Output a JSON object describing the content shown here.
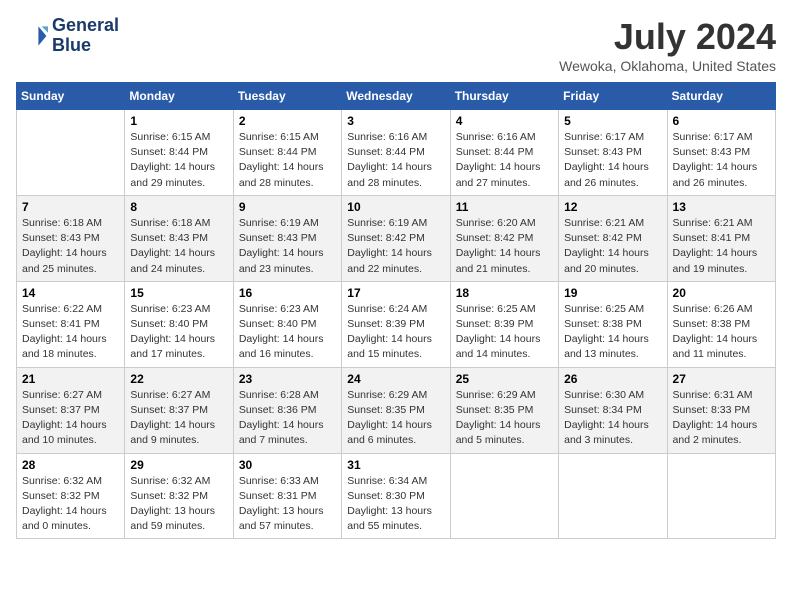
{
  "logo": {
    "line1": "General",
    "line2": "Blue"
  },
  "title": "July 2024",
  "location": "Wewoka, Oklahoma, United States",
  "weekdays": [
    "Sunday",
    "Monday",
    "Tuesday",
    "Wednesday",
    "Thursday",
    "Friday",
    "Saturday"
  ],
  "weeks": [
    [
      {
        "day": "",
        "info": ""
      },
      {
        "day": "1",
        "info": "Sunrise: 6:15 AM\nSunset: 8:44 PM\nDaylight: 14 hours\nand 29 minutes."
      },
      {
        "day": "2",
        "info": "Sunrise: 6:15 AM\nSunset: 8:44 PM\nDaylight: 14 hours\nand 28 minutes."
      },
      {
        "day": "3",
        "info": "Sunrise: 6:16 AM\nSunset: 8:44 PM\nDaylight: 14 hours\nand 28 minutes."
      },
      {
        "day": "4",
        "info": "Sunrise: 6:16 AM\nSunset: 8:44 PM\nDaylight: 14 hours\nand 27 minutes."
      },
      {
        "day": "5",
        "info": "Sunrise: 6:17 AM\nSunset: 8:43 PM\nDaylight: 14 hours\nand 26 minutes."
      },
      {
        "day": "6",
        "info": "Sunrise: 6:17 AM\nSunset: 8:43 PM\nDaylight: 14 hours\nand 26 minutes."
      }
    ],
    [
      {
        "day": "7",
        "info": "Sunrise: 6:18 AM\nSunset: 8:43 PM\nDaylight: 14 hours\nand 25 minutes."
      },
      {
        "day": "8",
        "info": "Sunrise: 6:18 AM\nSunset: 8:43 PM\nDaylight: 14 hours\nand 24 minutes."
      },
      {
        "day": "9",
        "info": "Sunrise: 6:19 AM\nSunset: 8:43 PM\nDaylight: 14 hours\nand 23 minutes."
      },
      {
        "day": "10",
        "info": "Sunrise: 6:19 AM\nSunset: 8:42 PM\nDaylight: 14 hours\nand 22 minutes."
      },
      {
        "day": "11",
        "info": "Sunrise: 6:20 AM\nSunset: 8:42 PM\nDaylight: 14 hours\nand 21 minutes."
      },
      {
        "day": "12",
        "info": "Sunrise: 6:21 AM\nSunset: 8:42 PM\nDaylight: 14 hours\nand 20 minutes."
      },
      {
        "day": "13",
        "info": "Sunrise: 6:21 AM\nSunset: 8:41 PM\nDaylight: 14 hours\nand 19 minutes."
      }
    ],
    [
      {
        "day": "14",
        "info": "Sunrise: 6:22 AM\nSunset: 8:41 PM\nDaylight: 14 hours\nand 18 minutes."
      },
      {
        "day": "15",
        "info": "Sunrise: 6:23 AM\nSunset: 8:40 PM\nDaylight: 14 hours\nand 17 minutes."
      },
      {
        "day": "16",
        "info": "Sunrise: 6:23 AM\nSunset: 8:40 PM\nDaylight: 14 hours\nand 16 minutes."
      },
      {
        "day": "17",
        "info": "Sunrise: 6:24 AM\nSunset: 8:39 PM\nDaylight: 14 hours\nand 15 minutes."
      },
      {
        "day": "18",
        "info": "Sunrise: 6:25 AM\nSunset: 8:39 PM\nDaylight: 14 hours\nand 14 minutes."
      },
      {
        "day": "19",
        "info": "Sunrise: 6:25 AM\nSunset: 8:38 PM\nDaylight: 14 hours\nand 13 minutes."
      },
      {
        "day": "20",
        "info": "Sunrise: 6:26 AM\nSunset: 8:38 PM\nDaylight: 14 hours\nand 11 minutes."
      }
    ],
    [
      {
        "day": "21",
        "info": "Sunrise: 6:27 AM\nSunset: 8:37 PM\nDaylight: 14 hours\nand 10 minutes."
      },
      {
        "day": "22",
        "info": "Sunrise: 6:27 AM\nSunset: 8:37 PM\nDaylight: 14 hours\nand 9 minutes."
      },
      {
        "day": "23",
        "info": "Sunrise: 6:28 AM\nSunset: 8:36 PM\nDaylight: 14 hours\nand 7 minutes."
      },
      {
        "day": "24",
        "info": "Sunrise: 6:29 AM\nSunset: 8:35 PM\nDaylight: 14 hours\nand 6 minutes."
      },
      {
        "day": "25",
        "info": "Sunrise: 6:29 AM\nSunset: 8:35 PM\nDaylight: 14 hours\nand 5 minutes."
      },
      {
        "day": "26",
        "info": "Sunrise: 6:30 AM\nSunset: 8:34 PM\nDaylight: 14 hours\nand 3 minutes."
      },
      {
        "day": "27",
        "info": "Sunrise: 6:31 AM\nSunset: 8:33 PM\nDaylight: 14 hours\nand 2 minutes."
      }
    ],
    [
      {
        "day": "28",
        "info": "Sunrise: 6:32 AM\nSunset: 8:32 PM\nDaylight: 14 hours\nand 0 minutes."
      },
      {
        "day": "29",
        "info": "Sunrise: 6:32 AM\nSunset: 8:32 PM\nDaylight: 13 hours\nand 59 minutes."
      },
      {
        "day": "30",
        "info": "Sunrise: 6:33 AM\nSunset: 8:31 PM\nDaylight: 13 hours\nand 57 minutes."
      },
      {
        "day": "31",
        "info": "Sunrise: 6:34 AM\nSunset: 8:30 PM\nDaylight: 13 hours\nand 55 minutes."
      },
      {
        "day": "",
        "info": ""
      },
      {
        "day": "",
        "info": ""
      },
      {
        "day": "",
        "info": ""
      }
    ]
  ]
}
